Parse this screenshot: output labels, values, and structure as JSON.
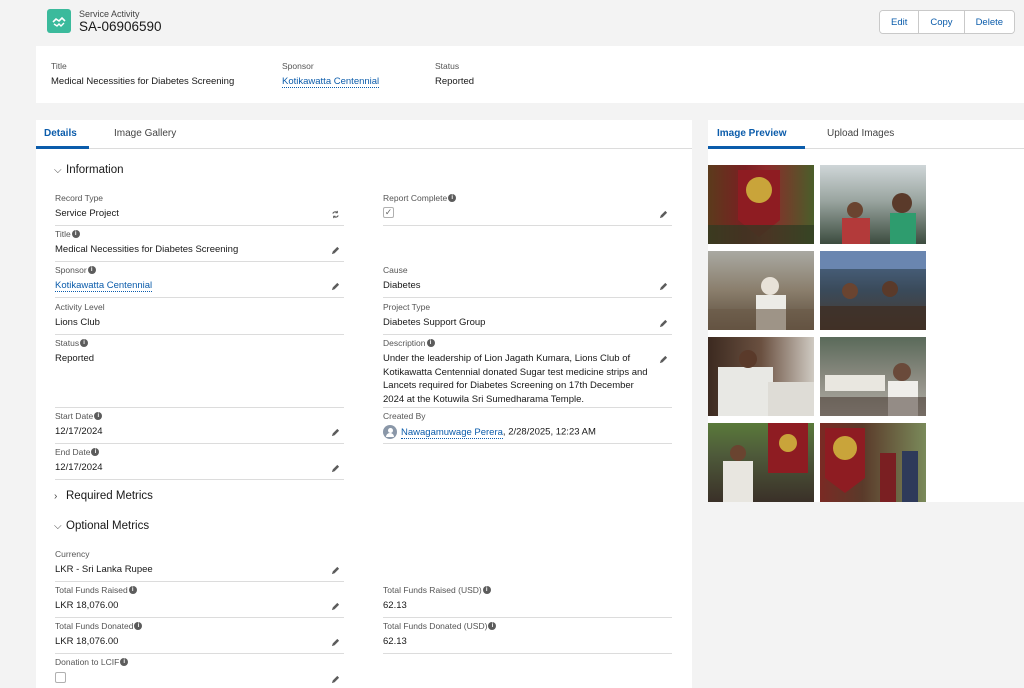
{
  "header": {
    "object_type": "Service Activity",
    "record_name": "SA-06906590",
    "buttons": {
      "edit": "Edit",
      "copy": "Copy",
      "delete": "Delete"
    }
  },
  "highlights": {
    "title_label": "Title",
    "title_value": "Medical Necessities for Diabetes Screening",
    "sponsor_label": "Sponsor",
    "sponsor_value": "Kotikawatta Centennial",
    "status_label": "Status",
    "status_value": "Reported"
  },
  "left_tabs": {
    "details": "Details",
    "gallery": "Image Gallery"
  },
  "sections": {
    "information": "Information",
    "required_metrics": "Required Metrics",
    "optional_metrics": "Optional Metrics"
  },
  "fields": {
    "record_type": {
      "label": "Record Type",
      "value": "Service Project"
    },
    "report_complete": {
      "label": "Report Complete",
      "checked": true
    },
    "title": {
      "label": "Title",
      "value": "Medical Necessities for Diabetes Screening"
    },
    "sponsor": {
      "label": "Sponsor",
      "value": "Kotikawatta Centennial"
    },
    "cause": {
      "label": "Cause",
      "value": "Diabetes"
    },
    "activity_level": {
      "label": "Activity Level",
      "value": "Lions Club"
    },
    "project_type": {
      "label": "Project Type",
      "value": "Diabetes Support Group"
    },
    "status": {
      "label": "Status",
      "value": "Reported"
    },
    "description": {
      "label": "Description",
      "value": "Under the leadership of Lion Jagath Kumara, Lions Club of Kotikawatta Centennial donated Sugar test medicine strips and Lancets required for Diabetes Screening on 17th December 2024 at the Kotuwila Sri Sumedharama Temple."
    },
    "start_date": {
      "label": "Start Date",
      "value": "12/17/2024"
    },
    "created_by": {
      "label": "Created By",
      "user": "Nawagamuwage Perera",
      "timestamp": ", 2/28/2025, 12:23 AM"
    },
    "end_date": {
      "label": "End Date",
      "value": "12/17/2024"
    },
    "currency": {
      "label": "Currency",
      "value": "LKR - Sri Lanka Rupee"
    },
    "total_funds_raised": {
      "label": "Total Funds Raised",
      "value": "LKR 18,076.00"
    },
    "total_funds_raised_usd": {
      "label": "Total Funds Raised (USD)",
      "value": "62.13"
    },
    "total_funds_donated": {
      "label": "Total Funds Donated",
      "value": "LKR 18,076.00"
    },
    "total_funds_donated_usd": {
      "label": "Total Funds Donated (USD)",
      "value": "62.13"
    },
    "donation_lcif": {
      "label": "Donation to LCIF",
      "checked": false
    }
  },
  "right_tabs": {
    "preview": "Image Preview",
    "upload": "Upload Images"
  },
  "colors": {
    "accent": "#0b5cab",
    "brand_icon": "#3bba9c"
  }
}
